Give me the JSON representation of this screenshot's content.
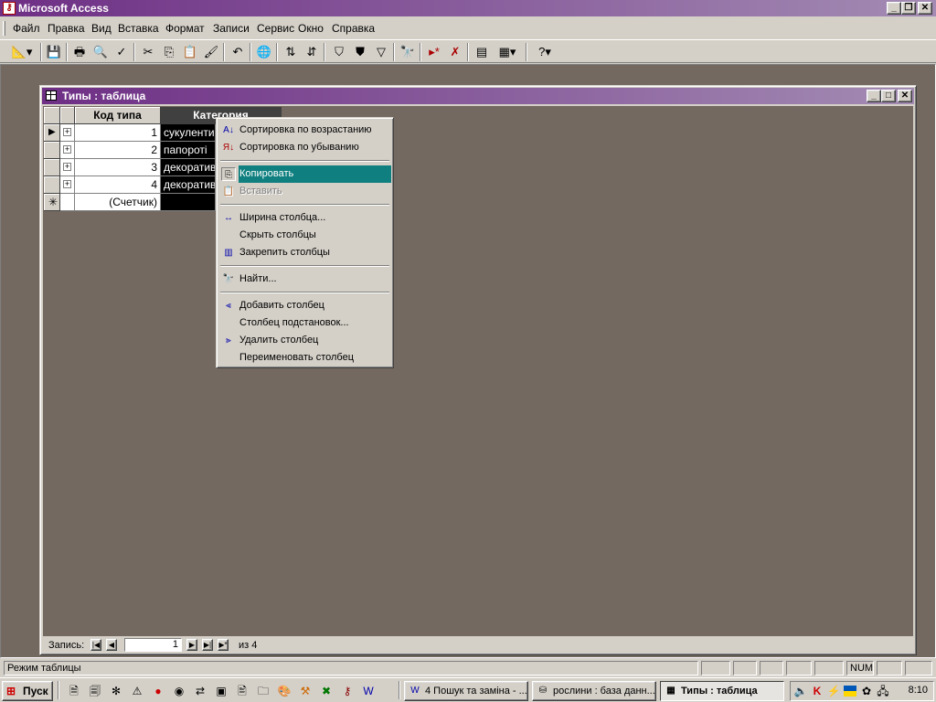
{
  "app": {
    "title": "Microsoft Access"
  },
  "menubar": [
    "Файл",
    "Правка",
    "Вид",
    "Вставка",
    "Формат",
    "Записи",
    "Сервис",
    "Окно",
    "Справка"
  ],
  "child_window": {
    "title": "Типы : таблица"
  },
  "table": {
    "headers": [
      "Код типа",
      "Категория"
    ],
    "rows": [
      {
        "id": "1",
        "category": "сукуленти"
      },
      {
        "id": "2",
        "category": "папороті"
      },
      {
        "id": "3",
        "category": "декоратив"
      },
      {
        "id": "4",
        "category": "декоратив"
      }
    ],
    "new_row_label": "(Счетчик)"
  },
  "context_menu": {
    "items": [
      {
        "label": "Сортировка по возрастанию",
        "icon": "sort-ascending-icon"
      },
      {
        "label": "Сортировка по убыванию",
        "icon": "sort-descending-icon"
      },
      {
        "label": "Копировать",
        "icon": "copy-icon",
        "highlighted": true
      },
      {
        "label": "Вставить",
        "icon": "paste-icon",
        "disabled": true
      },
      {
        "label": "Ширина столбца...",
        "icon": "column-width-icon"
      },
      {
        "label": "Скрыть столбцы",
        "icon": ""
      },
      {
        "label": "Закрепить столбцы",
        "icon": "freeze-columns-icon"
      },
      {
        "label": "Найти...",
        "icon": "binoculars-icon"
      },
      {
        "label": "Добавить столбец",
        "icon": "insert-column-icon"
      },
      {
        "label": "Столбец подстановок...",
        "icon": ""
      },
      {
        "label": "Удалить столбец",
        "icon": "delete-column-icon"
      },
      {
        "label": "Переименовать столбец",
        "icon": ""
      }
    ]
  },
  "record_nav": {
    "label": "Запись:",
    "current": "1",
    "total_text": "из 4"
  },
  "status": {
    "text": "Режим таблицы",
    "num": "NUM"
  },
  "taskbar": {
    "start": "Пуск",
    "tasks": [
      {
        "label": "4 Пошук та заміна - ...",
        "icon": "word-icon"
      },
      {
        "label": "рослини : база данн...",
        "icon": "database-icon"
      },
      {
        "label": "Типы : таблица",
        "icon": "table-icon",
        "active": true
      }
    ],
    "clock": "8:10"
  }
}
